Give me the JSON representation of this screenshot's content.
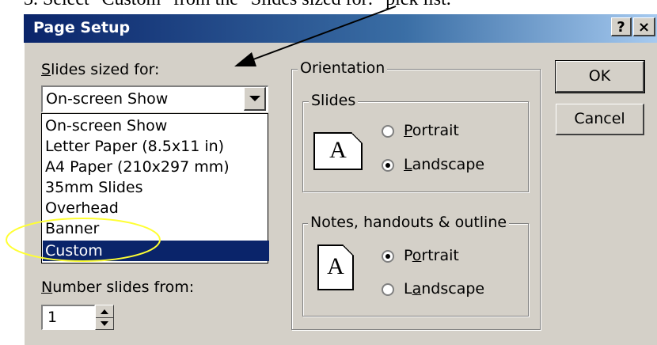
{
  "document": {
    "cropped_text": "3.   Select  \"Custom\"  from the  \"Slides sized for:\"  pick list."
  },
  "dialog": {
    "title": "Page Setup",
    "help_button": "?",
    "close_button": "×",
    "slides_sized_for": {
      "label_first": "S",
      "label_rest": "lides sized for:",
      "selected_value": "On-screen Show",
      "options": [
        "On-screen Show",
        "Letter Paper (8.5x11 in)",
        "A4 Paper (210x297 mm)",
        "35mm Slides",
        "Overhead",
        "Banner",
        "Custom"
      ],
      "highlighted_option": "Custom"
    },
    "number_slides_from": {
      "label_first": "N",
      "label_rest": "umber slides from:",
      "value": "1"
    },
    "orientation": {
      "label": "Orientation",
      "slides": {
        "label": "Slides",
        "page_glyph": "A",
        "portrait": {
          "pre": "",
          "u": "P",
          "post": "ortrait",
          "checked": false
        },
        "landscape": {
          "pre": "",
          "u": "L",
          "post": "andscape",
          "checked": true
        }
      },
      "notes": {
        "label": "Notes, handouts & outline",
        "page_glyph": "A",
        "portrait": {
          "pre": "P",
          "u": "o",
          "post": "rtrait",
          "checked": true
        },
        "landscape": {
          "pre": "L",
          "u": "a",
          "post": "ndscape",
          "checked": false
        }
      }
    },
    "ok_label": "OK",
    "cancel_label": "Cancel"
  },
  "annotations": {
    "arrow_color": "#000000",
    "ellipse_color": "#ffff33"
  },
  "colors": {
    "titlebar_start": "#0a246a",
    "titlebar_end": "#a6caf0",
    "face": "#d4d0c8",
    "selection": "#0a246a"
  }
}
